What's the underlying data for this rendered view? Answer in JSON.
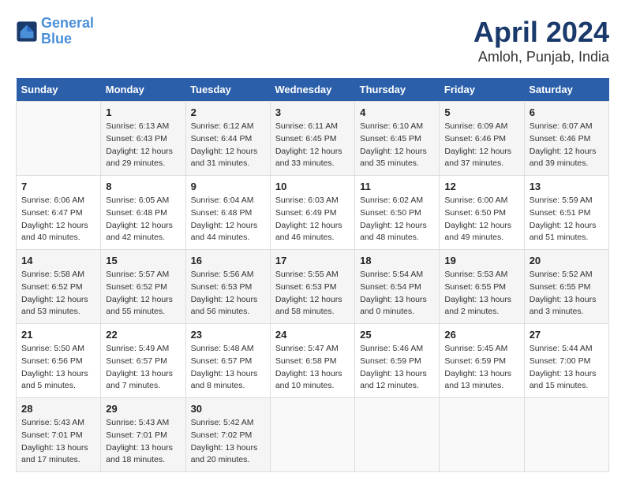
{
  "header": {
    "logo_line1": "General",
    "logo_line2": "Blue",
    "title": "April 2024",
    "location": "Amloh, Punjab, India"
  },
  "columns": [
    "Sunday",
    "Monday",
    "Tuesday",
    "Wednesday",
    "Thursday",
    "Friday",
    "Saturday"
  ],
  "weeks": [
    [
      {
        "day": "",
        "details": []
      },
      {
        "day": "1",
        "details": [
          "Sunrise: 6:13 AM",
          "Sunset: 6:43 PM",
          "Daylight: 12 hours",
          "and 29 minutes."
        ]
      },
      {
        "day": "2",
        "details": [
          "Sunrise: 6:12 AM",
          "Sunset: 6:44 PM",
          "Daylight: 12 hours",
          "and 31 minutes."
        ]
      },
      {
        "day": "3",
        "details": [
          "Sunrise: 6:11 AM",
          "Sunset: 6:45 PM",
          "Daylight: 12 hours",
          "and 33 minutes."
        ]
      },
      {
        "day": "4",
        "details": [
          "Sunrise: 6:10 AM",
          "Sunset: 6:45 PM",
          "Daylight: 12 hours",
          "and 35 minutes."
        ]
      },
      {
        "day": "5",
        "details": [
          "Sunrise: 6:09 AM",
          "Sunset: 6:46 PM",
          "Daylight: 12 hours",
          "and 37 minutes."
        ]
      },
      {
        "day": "6",
        "details": [
          "Sunrise: 6:07 AM",
          "Sunset: 6:46 PM",
          "Daylight: 12 hours",
          "and 39 minutes."
        ]
      }
    ],
    [
      {
        "day": "7",
        "details": [
          "Sunrise: 6:06 AM",
          "Sunset: 6:47 PM",
          "Daylight: 12 hours",
          "and 40 minutes."
        ]
      },
      {
        "day": "8",
        "details": [
          "Sunrise: 6:05 AM",
          "Sunset: 6:48 PM",
          "Daylight: 12 hours",
          "and 42 minutes."
        ]
      },
      {
        "day": "9",
        "details": [
          "Sunrise: 6:04 AM",
          "Sunset: 6:48 PM",
          "Daylight: 12 hours",
          "and 44 minutes."
        ]
      },
      {
        "day": "10",
        "details": [
          "Sunrise: 6:03 AM",
          "Sunset: 6:49 PM",
          "Daylight: 12 hours",
          "and 46 minutes."
        ]
      },
      {
        "day": "11",
        "details": [
          "Sunrise: 6:02 AM",
          "Sunset: 6:50 PM",
          "Daylight: 12 hours",
          "and 48 minutes."
        ]
      },
      {
        "day": "12",
        "details": [
          "Sunrise: 6:00 AM",
          "Sunset: 6:50 PM",
          "Daylight: 12 hours",
          "and 49 minutes."
        ]
      },
      {
        "day": "13",
        "details": [
          "Sunrise: 5:59 AM",
          "Sunset: 6:51 PM",
          "Daylight: 12 hours",
          "and 51 minutes."
        ]
      }
    ],
    [
      {
        "day": "14",
        "details": [
          "Sunrise: 5:58 AM",
          "Sunset: 6:52 PM",
          "Daylight: 12 hours",
          "and 53 minutes."
        ]
      },
      {
        "day": "15",
        "details": [
          "Sunrise: 5:57 AM",
          "Sunset: 6:52 PM",
          "Daylight: 12 hours",
          "and 55 minutes."
        ]
      },
      {
        "day": "16",
        "details": [
          "Sunrise: 5:56 AM",
          "Sunset: 6:53 PM",
          "Daylight: 12 hours",
          "and 56 minutes."
        ]
      },
      {
        "day": "17",
        "details": [
          "Sunrise: 5:55 AM",
          "Sunset: 6:53 PM",
          "Daylight: 12 hours",
          "and 58 minutes."
        ]
      },
      {
        "day": "18",
        "details": [
          "Sunrise: 5:54 AM",
          "Sunset: 6:54 PM",
          "Daylight: 13 hours",
          "and 0 minutes."
        ]
      },
      {
        "day": "19",
        "details": [
          "Sunrise: 5:53 AM",
          "Sunset: 6:55 PM",
          "Daylight: 13 hours",
          "and 2 minutes."
        ]
      },
      {
        "day": "20",
        "details": [
          "Sunrise: 5:52 AM",
          "Sunset: 6:55 PM",
          "Daylight: 13 hours",
          "and 3 minutes."
        ]
      }
    ],
    [
      {
        "day": "21",
        "details": [
          "Sunrise: 5:50 AM",
          "Sunset: 6:56 PM",
          "Daylight: 13 hours",
          "and 5 minutes."
        ]
      },
      {
        "day": "22",
        "details": [
          "Sunrise: 5:49 AM",
          "Sunset: 6:57 PM",
          "Daylight: 13 hours",
          "and 7 minutes."
        ]
      },
      {
        "day": "23",
        "details": [
          "Sunrise: 5:48 AM",
          "Sunset: 6:57 PM",
          "Daylight: 13 hours",
          "and 8 minutes."
        ]
      },
      {
        "day": "24",
        "details": [
          "Sunrise: 5:47 AM",
          "Sunset: 6:58 PM",
          "Daylight: 13 hours",
          "and 10 minutes."
        ]
      },
      {
        "day": "25",
        "details": [
          "Sunrise: 5:46 AM",
          "Sunset: 6:59 PM",
          "Daylight: 13 hours",
          "and 12 minutes."
        ]
      },
      {
        "day": "26",
        "details": [
          "Sunrise: 5:45 AM",
          "Sunset: 6:59 PM",
          "Daylight: 13 hours",
          "and 13 minutes."
        ]
      },
      {
        "day": "27",
        "details": [
          "Sunrise: 5:44 AM",
          "Sunset: 7:00 PM",
          "Daylight: 13 hours",
          "and 15 minutes."
        ]
      }
    ],
    [
      {
        "day": "28",
        "details": [
          "Sunrise: 5:43 AM",
          "Sunset: 7:01 PM",
          "Daylight: 13 hours",
          "and 17 minutes."
        ]
      },
      {
        "day": "29",
        "details": [
          "Sunrise: 5:43 AM",
          "Sunset: 7:01 PM",
          "Daylight: 13 hours",
          "and 18 minutes."
        ]
      },
      {
        "day": "30",
        "details": [
          "Sunrise: 5:42 AM",
          "Sunset: 7:02 PM",
          "Daylight: 13 hours",
          "and 20 minutes."
        ]
      },
      {
        "day": "",
        "details": []
      },
      {
        "day": "",
        "details": []
      },
      {
        "day": "",
        "details": []
      },
      {
        "day": "",
        "details": []
      }
    ]
  ]
}
